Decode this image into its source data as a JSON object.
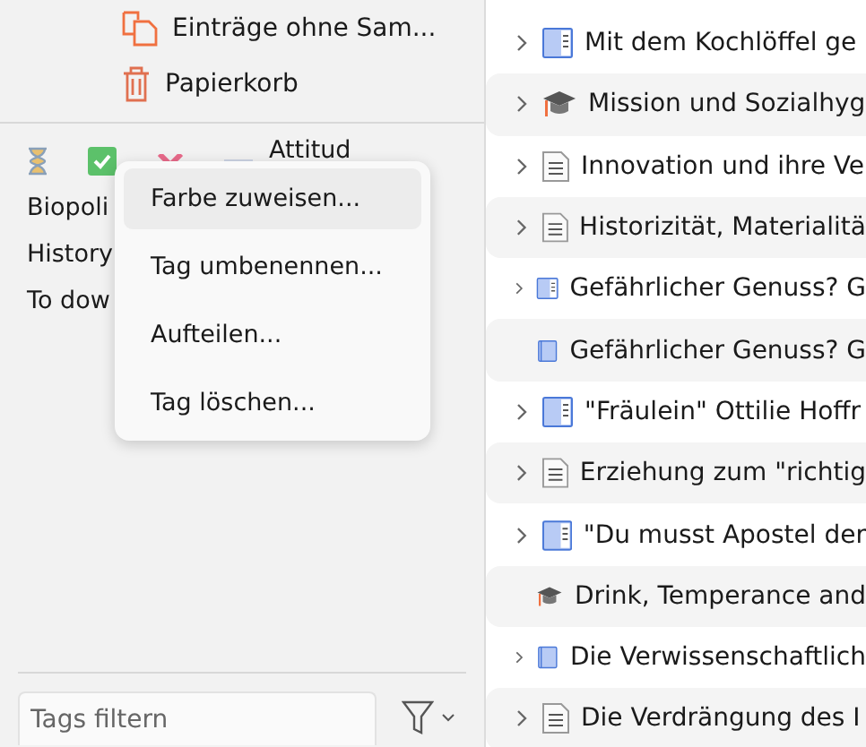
{
  "collections": [
    {
      "kind": "unfiled",
      "label": "Einträge ohne Sam..."
    },
    {
      "kind": "trash",
      "label": "Papierkorb"
    }
  ],
  "emoji_tags": [
    {
      "kind": "hourglass"
    },
    {
      "kind": "check"
    },
    {
      "kind": "cross"
    },
    {
      "kind": "dash"
    }
  ],
  "tags": [
    "Attitud",
    "Biopoli",
    "History",
    "To dow"
  ],
  "tag_filter": {
    "placeholder": "Tags filtern"
  },
  "context_menu": [
    {
      "label": "Farbe zuweisen...",
      "selected": true
    },
    {
      "label": "Tag umbenennen...",
      "selected": false
    },
    {
      "label": "Aufteilen...",
      "selected": false
    },
    {
      "label": "Tag löschen...",
      "selected": false
    }
  ],
  "items": [
    {
      "kind": "book",
      "title": "Mit dem Kochlöffel ge",
      "expandable": true
    },
    {
      "kind": "thesis",
      "title": "Mission und Sozialhyg",
      "expandable": true
    },
    {
      "kind": "document",
      "title": "Innovation und ihre Ve",
      "expandable": true
    },
    {
      "kind": "document",
      "title": "Historizität, Materialitä",
      "expandable": true
    },
    {
      "kind": "book",
      "title": "Gefährlicher Genuss? G",
      "expandable": true
    },
    {
      "kind": "book-plain",
      "title": "Gefährlicher Genuss? G",
      "expandable": false
    },
    {
      "kind": "book",
      "title": "\"Fräulein\" Ottilie Hoffr",
      "expandable": true
    },
    {
      "kind": "document",
      "title": "Erziehung zum \"richtig",
      "expandable": true
    },
    {
      "kind": "book",
      "title": "\"Du musst Apostel der",
      "expandable": true
    },
    {
      "kind": "thesis",
      "title": "Drink, Temperance and",
      "expandable": false
    },
    {
      "kind": "book-plain",
      "title": "Die Verwissenschaftlich",
      "expandable": true
    },
    {
      "kind": "document",
      "title": "Die Verdrängung des I",
      "expandable": true
    }
  ]
}
